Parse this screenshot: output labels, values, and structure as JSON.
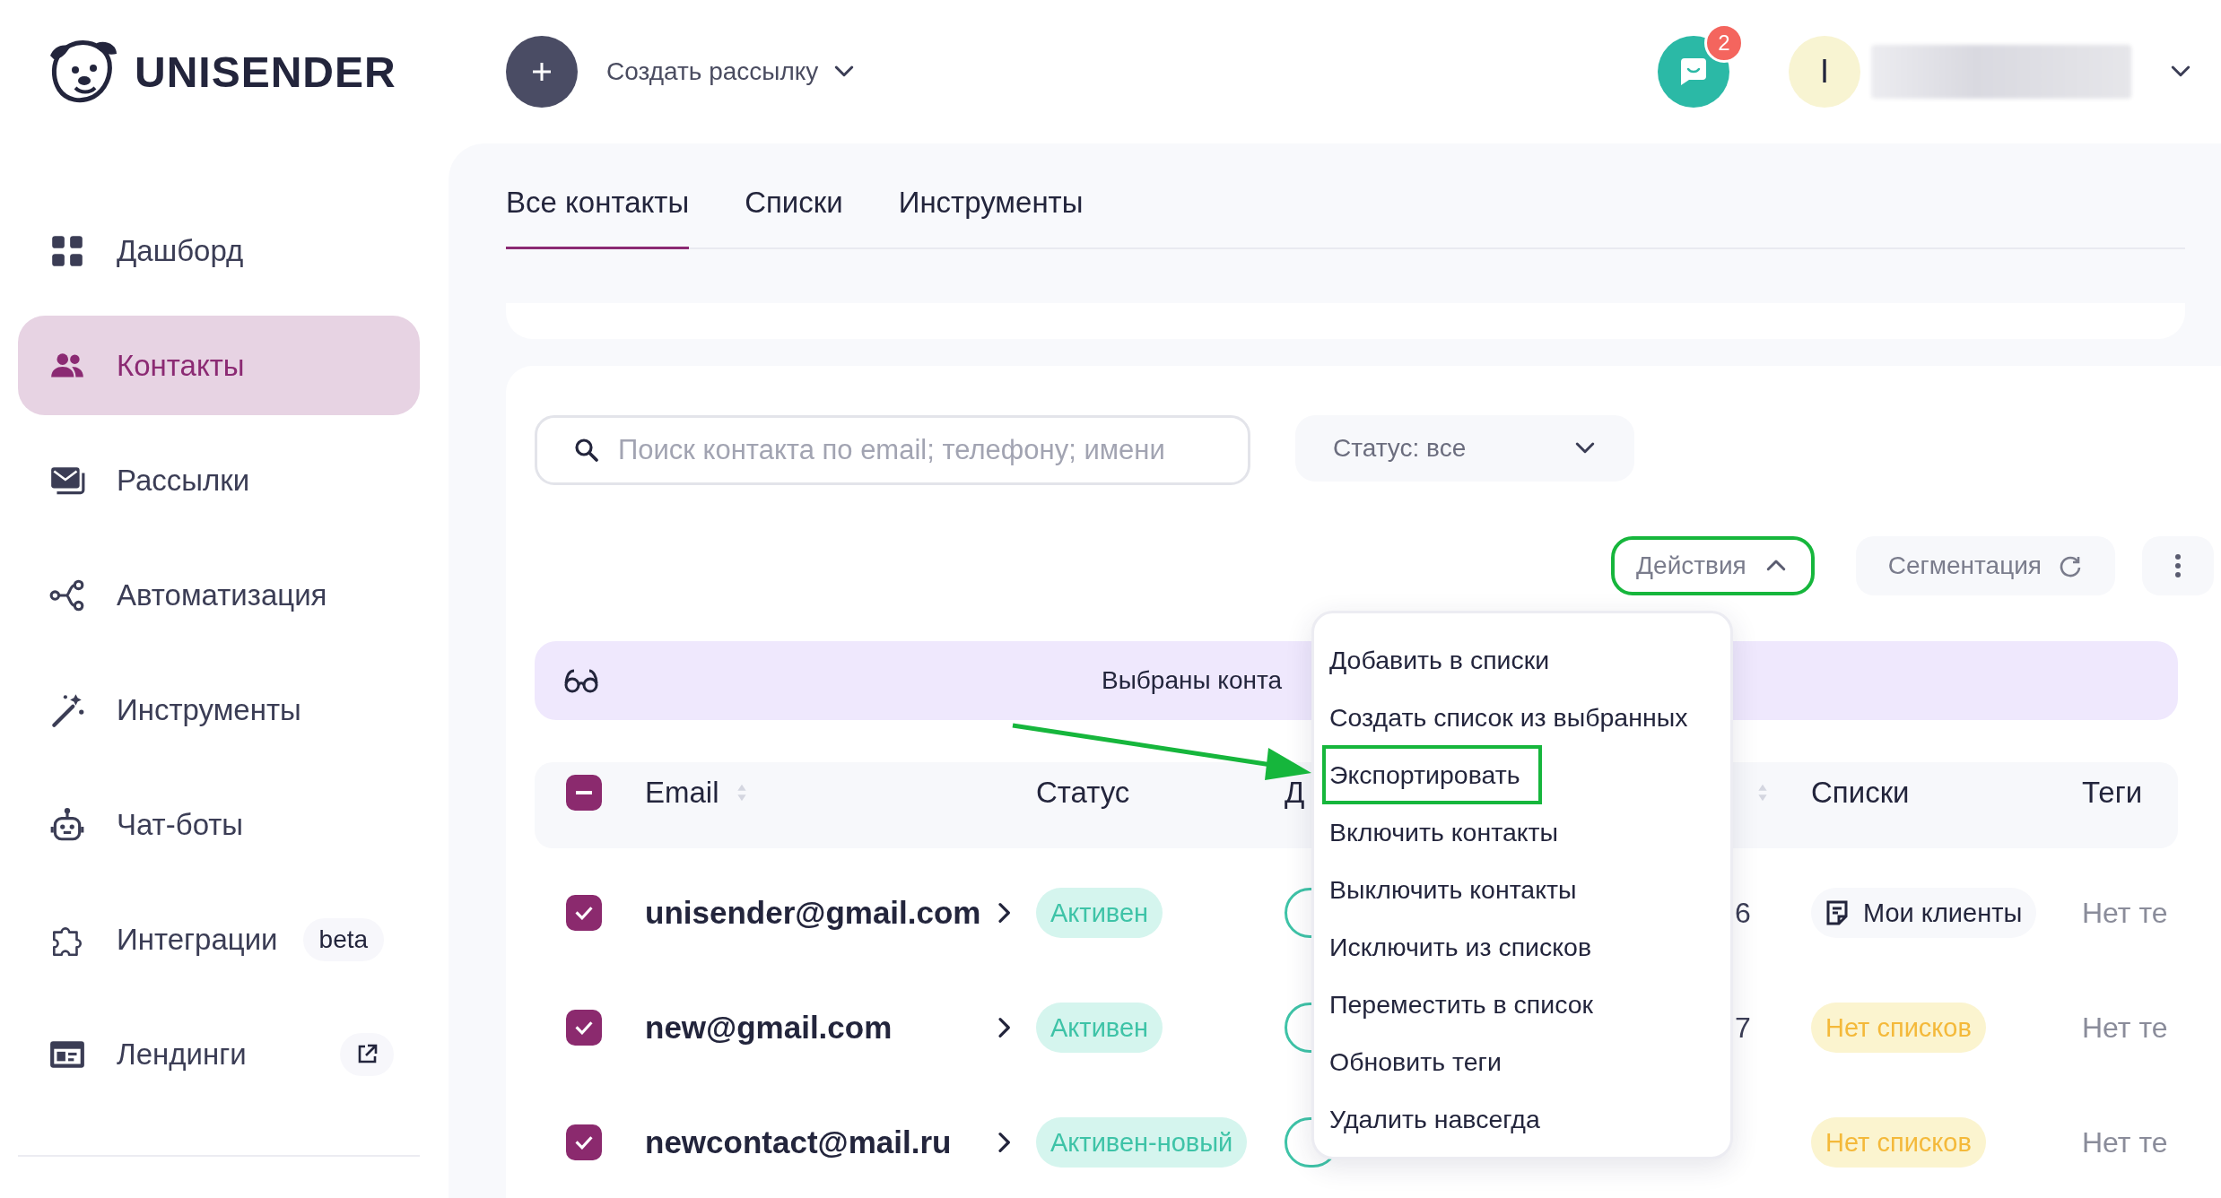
{
  "header": {
    "logo": "UNISENDER",
    "create_label": "Создать рассылку",
    "chat_badge": "2",
    "avatar_initial": "I"
  },
  "sidebar": {
    "items": [
      {
        "label": "Дашборд",
        "kind": "dashboard",
        "selected": false
      },
      {
        "label": "Контакты",
        "kind": "contacts",
        "selected": true
      },
      {
        "label": "Рассылки",
        "kind": "mail",
        "selected": false
      },
      {
        "label": "Автоматизация",
        "kind": "automation",
        "selected": false
      },
      {
        "label": "Инструменты",
        "kind": "wand",
        "selected": false
      },
      {
        "label": "Чат-боты",
        "kind": "bot",
        "selected": false
      },
      {
        "label": "Интеграции",
        "kind": "puzzle",
        "selected": false,
        "badge": "beta"
      },
      {
        "label": "Лендинги",
        "kind": "landing",
        "selected": false,
        "external": true
      }
    ]
  },
  "tabs": [
    {
      "label": "Все контакты",
      "selected": true
    },
    {
      "label": "Списки",
      "selected": false
    },
    {
      "label": "Инструменты",
      "selected": false
    }
  ],
  "search": {
    "placeholder": "Поиск контакта по email; телефону; имени"
  },
  "status_filter": "Статус: все",
  "actions_button": {
    "label": "Действия",
    "expanded": true,
    "annotated": true
  },
  "segmentation_button": "Сегментация",
  "selection_banner": "Выбраны конта",
  "table": {
    "select_all_checked": true,
    "select_all_partial": true,
    "columns": [
      {
        "label": "Email",
        "sortable": true
      },
      {
        "label": "Статус",
        "sortable": false
      },
      {
        "label": "Д",
        "sortable": false
      },
      {
        "sortable": true
      },
      {
        "label": "Списки",
        "sortable": false
      },
      {
        "label": "Теги",
        "sortable": false
      }
    ],
    "rows": [
      {
        "checked": true,
        "email": "unisender@gmail.com",
        "status": "Активен",
        "column_4": "6",
        "lists": {
          "kind": "list",
          "text": "Мои клиенты"
        },
        "tags": "Нет те"
      },
      {
        "checked": true,
        "email": "new@gmail.com",
        "status": "Активен",
        "column_4": "7",
        "lists": {
          "kind": "none",
          "text": "Нет списков"
        },
        "tags": "Нет те"
      },
      {
        "checked": true,
        "email": "newcontact@mail.ru",
        "status": "Активен-новый",
        "lists": {
          "kind": "none",
          "text": "Нет списков"
        },
        "tags": "Нет те"
      }
    ]
  },
  "actions_menu": {
    "items": [
      {
        "label": "Добавить в списки",
        "annotated": false
      },
      {
        "label": "Создать список из выбранных",
        "annotated": false
      },
      {
        "label": "Экспортировать",
        "annotated": true
      },
      {
        "label": "Включить контакты",
        "annotated": false
      },
      {
        "label": "Выключить контакты",
        "annotated": false
      },
      {
        "label": "Исключить из списков",
        "annotated": false
      },
      {
        "label": "Переместить в список",
        "annotated": false
      },
      {
        "label": "Обновить теги",
        "annotated": false
      },
      {
        "label": "Удалить навсегда",
        "annotated": false
      }
    ]
  }
}
